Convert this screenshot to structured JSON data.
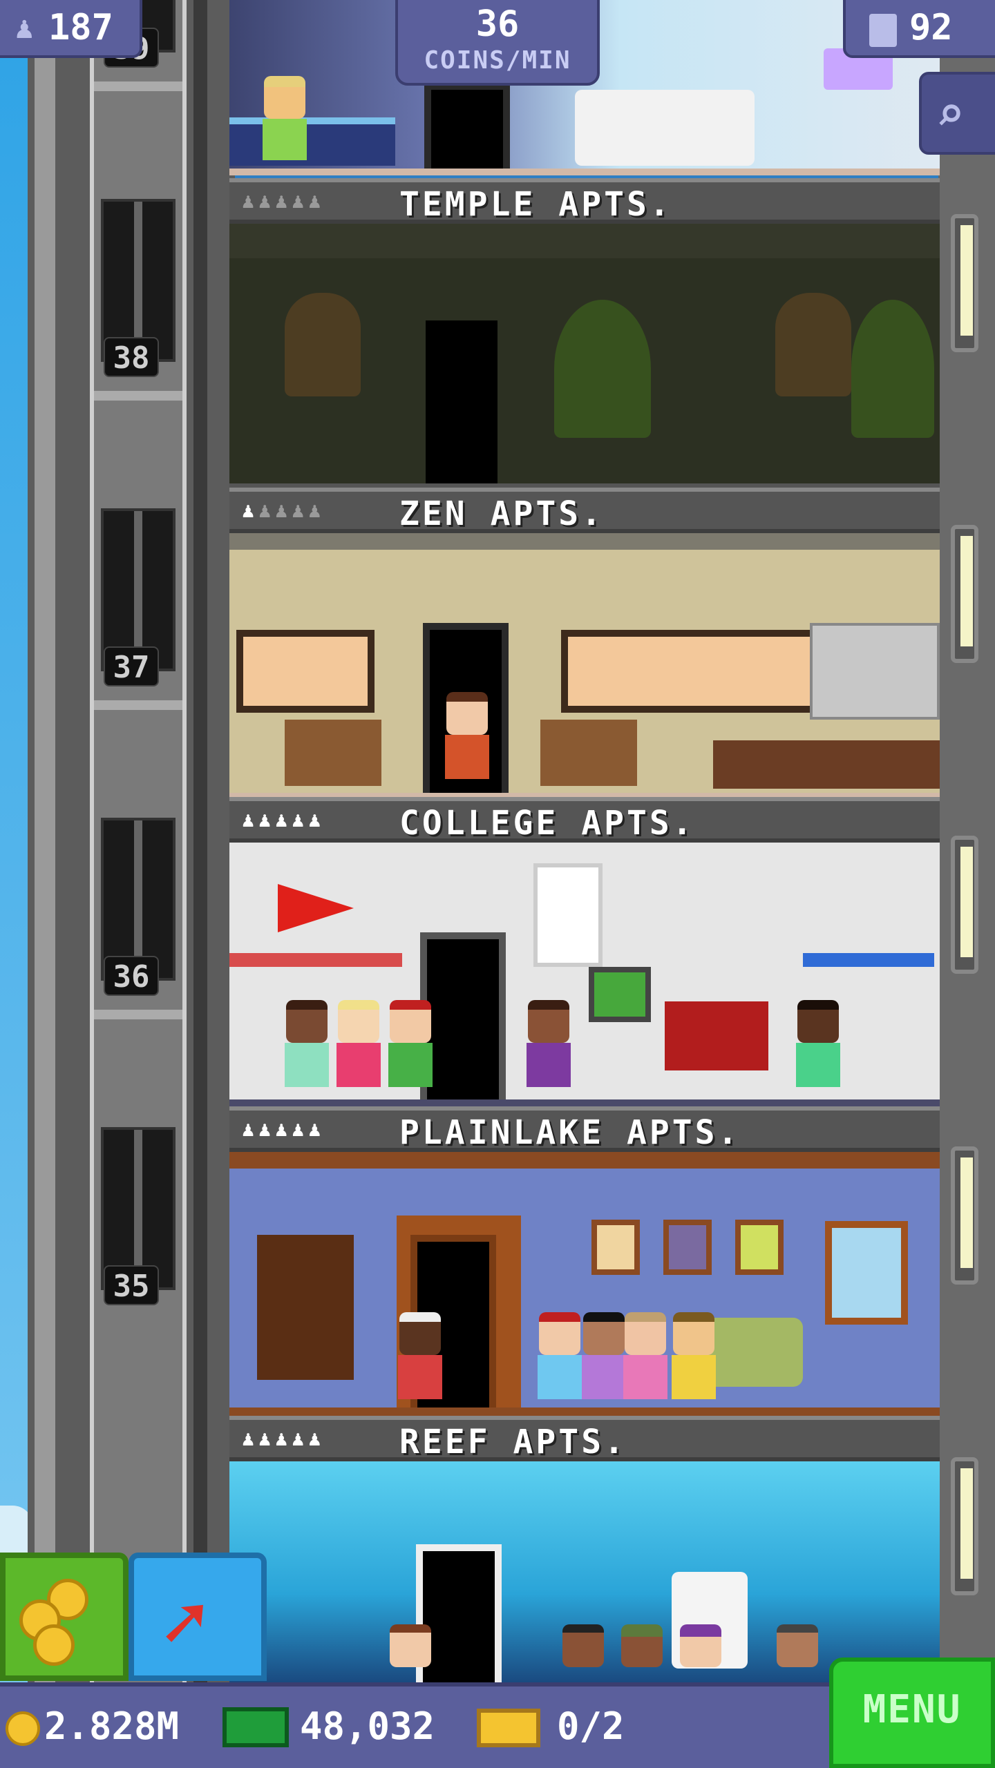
{
  "hud": {
    "population": "187",
    "coins_per_min_value": "36",
    "coins_per_min_unit": "COINS/MIN",
    "floor_count": "92",
    "icons": {
      "population": "person-icon",
      "floors": "building-icon",
      "zoom": "magnifier-icon"
    }
  },
  "elevator": {
    "floor_numbers": [
      "39",
      "38",
      "37",
      "36",
      "35"
    ]
  },
  "floors": [
    {
      "name": "TEMPLE APTS.",
      "residents": 5,
      "filled": 0,
      "theme": "temple"
    },
    {
      "name": "ZEN APTS.",
      "residents": 5,
      "filled": 1,
      "theme": "zen"
    },
    {
      "name": "COLLEGE APTS.",
      "residents": 5,
      "filled": 5,
      "theme": "college"
    },
    {
      "name": "PLAINLAKE APTS.",
      "residents": 5,
      "filled": 5,
      "theme": "plainlake"
    },
    {
      "name": "REEF APTS.",
      "residents": 5,
      "filled": 5,
      "theme": "reef"
    }
  ],
  "bottom": {
    "coins": "2.828M",
    "bux": "48,032",
    "tickets": "0/2",
    "menu_label": "MENU",
    "icons": {
      "coins": "coin-icon",
      "bux": "bux-icon",
      "tickets": "ticket-icon",
      "coins_button": "coin-stack-icon",
      "build_button": "raise-arrow-icon"
    }
  },
  "colors": {
    "hud": "#5b5f9c",
    "menu": "#2fcf32",
    "build": "#36a8ec",
    "coins_button": "#5cb82a"
  }
}
